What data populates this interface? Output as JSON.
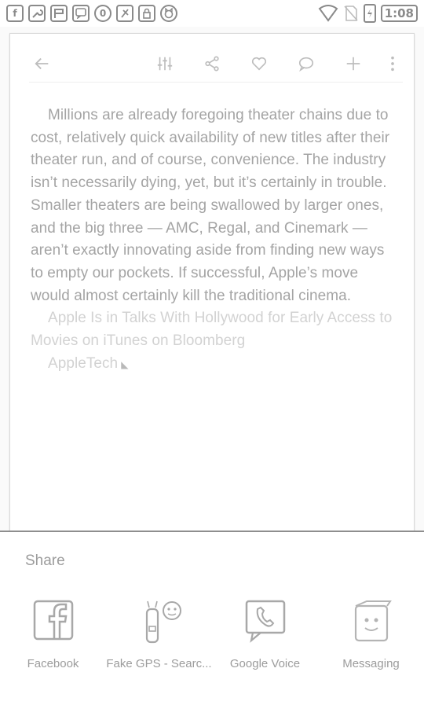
{
  "status_bar": {
    "left_icons": [
      "facebook-notification-icon",
      "wrench-icon",
      "flag-icon",
      "voice-notification-icon",
      "circle-o-icon",
      "flashlight-icon",
      "lock-icon",
      "cat-icon"
    ],
    "right_icons": [
      "wifi-icon",
      "no-sim-icon",
      "battery-icon"
    ],
    "time": "1:08"
  },
  "toolbar": {
    "icons": [
      "back-arrow-icon",
      "sliders-icon",
      "share-icon",
      "heart-icon",
      "comment-icon",
      "plus-icon",
      "more-vert-icon"
    ]
  },
  "article": {
    "paragraph": "Millions are already foregoing theater chains due to cost, relatively quick availability of new titles after their theater run, and of course, convenience. The industry isn’t necessarily dying, yet, but it’s certainly in trouble. Smaller theaters are being swallowed by larger ones, and the big three — AMC, Regal, and Cinemark — aren’t exactly innovating aside from finding new ways to empty our pockets. If successful, Apple’s move would almost certainly kill the traditional cinema.",
    "link_text": "Apple Is in Talks With Hollywood for Early Access to Movies on iTunes on Bloomberg",
    "source_text": "AppleTech"
  },
  "share": {
    "title": "Share",
    "apps": [
      {
        "label": "Facebook",
        "icon": "facebook-icon"
      },
      {
        "label": "Fake GPS - Searc...",
        "icon": "fake-gps-icon"
      },
      {
        "label": "Google Voice",
        "icon": "google-voice-icon"
      },
      {
        "label": "Messaging",
        "icon": "messaging-icon"
      }
    ]
  },
  "colors": {
    "text": "#a4a4a4",
    "link": "#d2d2d2",
    "icon": "#bdbdbd",
    "divider": "#8e8e8e"
  }
}
